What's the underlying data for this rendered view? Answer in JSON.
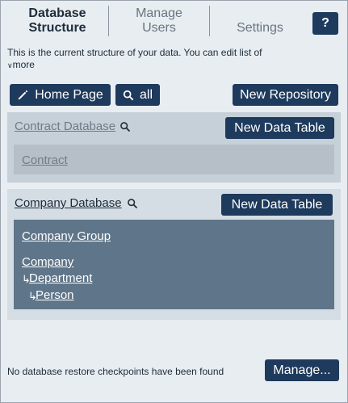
{
  "tabs": [
    {
      "label_line1": "Database",
      "label_line2": "Structure"
    },
    {
      "label_line1": "Manage",
      "label_line2": "Users"
    },
    {
      "label_line1": "Settings",
      "label_line2": ""
    }
  ],
  "help_label": "?",
  "intro": {
    "text": "This is the current structure of your data. You can edit list of",
    "more_label": "more"
  },
  "toolbar": {
    "home_label": "Home Page",
    "search_label": "all",
    "new_repo_label": "New Repository"
  },
  "databases": [
    {
      "name": "Contract Database",
      "new_table_label": "New Data Table",
      "tables": [
        {
          "name": "Contract"
        }
      ]
    },
    {
      "name": "Company Database",
      "new_table_label": "New Data Table",
      "tables": [
        {
          "name": "Company Group"
        },
        {
          "name": "Company"
        },
        {
          "name": "Department"
        },
        {
          "name": "Person"
        }
      ]
    }
  ],
  "footer": {
    "text": "No database restore checkpoints have been found",
    "manage_label": "Manage..."
  },
  "colors": {
    "button_bg": "#1e3a5c",
    "panel_bg": "#e8edf1",
    "selected_tables_bg": "#5f7589"
  }
}
